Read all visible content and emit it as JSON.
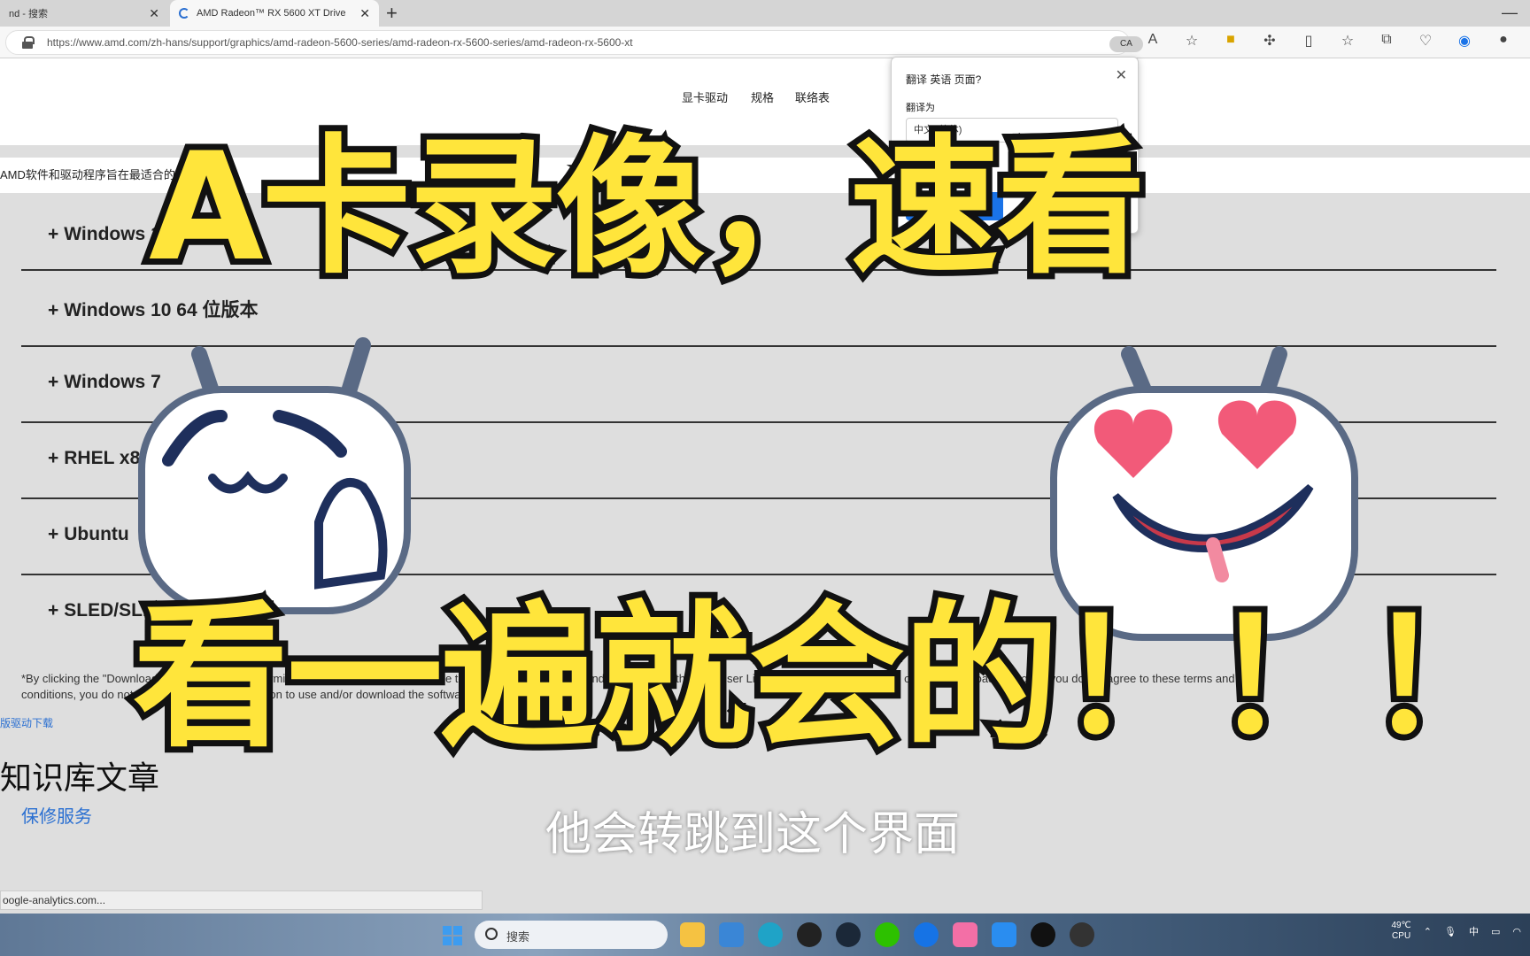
{
  "browser": {
    "tabs": [
      {
        "title": "nd - 搜索",
        "active": false
      },
      {
        "title": "AMD Radeon™ RX 5600 XT Drive",
        "active": true
      }
    ],
    "url": "https://www.amd.com/zh-hans/support/graphics/amd-radeon-5600-series/amd-radeon-rx-5600-series/amd-radeon-rx-5600-xt",
    "translate_chip": "CA"
  },
  "page": {
    "nav": [
      "显卡驱动",
      "规格",
      "联络表"
    ],
    "notice": "AMD软件和驱动程序旨在最适合的",
    "os_rows": [
      "Windows 11 64 位",
      "Windows 10 64 位版本",
      "Windows 7",
      "RHEL x86",
      "Ubuntu",
      "SLED/SLES"
    ],
    "legal_line1": "*By clicking the \"Download\" button, you are confirming that you have read and agree to be bound by the terms and conditions of the End User License Agreement by clicking on the \"Download\" button. If you do not agree to these terms and",
    "legal_line2": "conditions, you do not have a license or permission to use and/or download the software.",
    "old_driver_link": "版驱动下载",
    "kb_title": "知识库文章",
    "kb_link": "保修服务",
    "status_url": "oogle-analytics.com..."
  },
  "translate_popup": {
    "title": "翻译 英语 页面?",
    "label": "翻译为",
    "language": "中文 (简体)",
    "checkbox_label": "始终翻译",
    "button": "翻译"
  },
  "overlay": {
    "title_top": "A卡录像，速看",
    "title_bottom": "看一遍就会的！！！",
    "subtitle": "他会转跳到这个界面"
  },
  "taskbar": {
    "search_placeholder": "搜索",
    "temp": "49℃",
    "cpu": "CPU",
    "ime": "中"
  }
}
